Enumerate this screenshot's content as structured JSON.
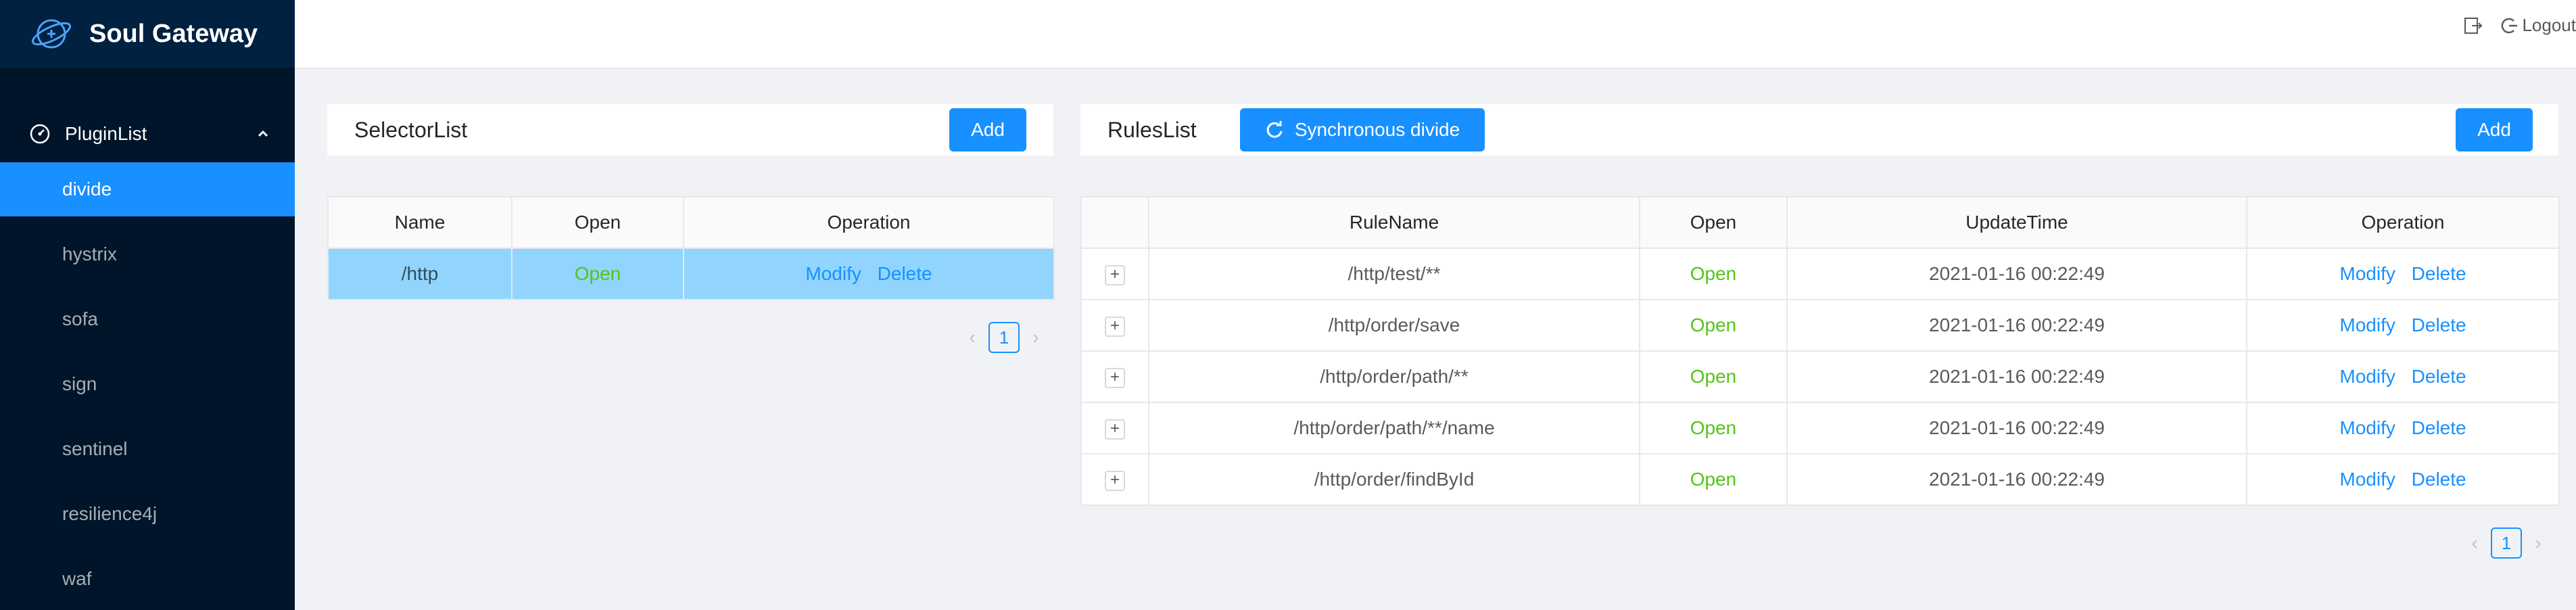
{
  "app": {
    "title": "Soul Gateway"
  },
  "sidebar": {
    "group_label": "PluginList",
    "items": [
      {
        "label": "divide",
        "active": true
      },
      {
        "label": "hystrix"
      },
      {
        "label": "sofa"
      },
      {
        "label": "sign"
      },
      {
        "label": "sentinel"
      },
      {
        "label": "resilience4j"
      },
      {
        "label": "waf"
      }
    ]
  },
  "header": {
    "logout_label": "Logout"
  },
  "selector": {
    "title": "SelectorList",
    "add_label": "Add",
    "columns": [
      "Name",
      "Open",
      "Operation"
    ],
    "rows": [
      {
        "name": "/http",
        "open": "Open",
        "modify": "Modify",
        "delete": "Delete"
      }
    ],
    "page": "1"
  },
  "rules": {
    "title": "RulesList",
    "sync_label": "Synchronous divide",
    "add_label": "Add",
    "columns": [
      "RuleName",
      "Open",
      "UpdateTime",
      "Operation"
    ],
    "rows": [
      {
        "expand": "+",
        "name": "/http/test/**",
        "open": "Open",
        "time": "2021-01-16 00:22:49",
        "modify": "Modify",
        "delete": "Delete"
      },
      {
        "expand": "+",
        "name": "/http/order/save",
        "open": "Open",
        "time": "2021-01-16 00:22:49",
        "modify": "Modify",
        "delete": "Delete"
      },
      {
        "expand": "+",
        "name": "/http/order/path/**",
        "open": "Open",
        "time": "2021-01-16 00:22:49",
        "modify": "Modify",
        "delete": "Delete"
      },
      {
        "expand": "+",
        "name": "/http/order/path/**/name",
        "open": "Open",
        "time": "2021-01-16 00:22:49",
        "modify": "Modify",
        "delete": "Delete"
      },
      {
        "expand": "+",
        "name": "/http/order/findById",
        "open": "Open",
        "time": "2021-01-16 00:22:49",
        "modify": "Modify",
        "delete": "Delete"
      }
    ],
    "page": "1"
  },
  "icons": {
    "logo": "soul-logo-icon",
    "group": "dashboard-icon",
    "chevron": "chevron-up-icon",
    "export": "export-icon",
    "logout": "logout-icon",
    "sync": "sync-icon"
  },
  "colors": {
    "sidebar": "#001529",
    "primary": "#1890ff",
    "open": "#52c41a",
    "selected": "#91d5ff"
  }
}
